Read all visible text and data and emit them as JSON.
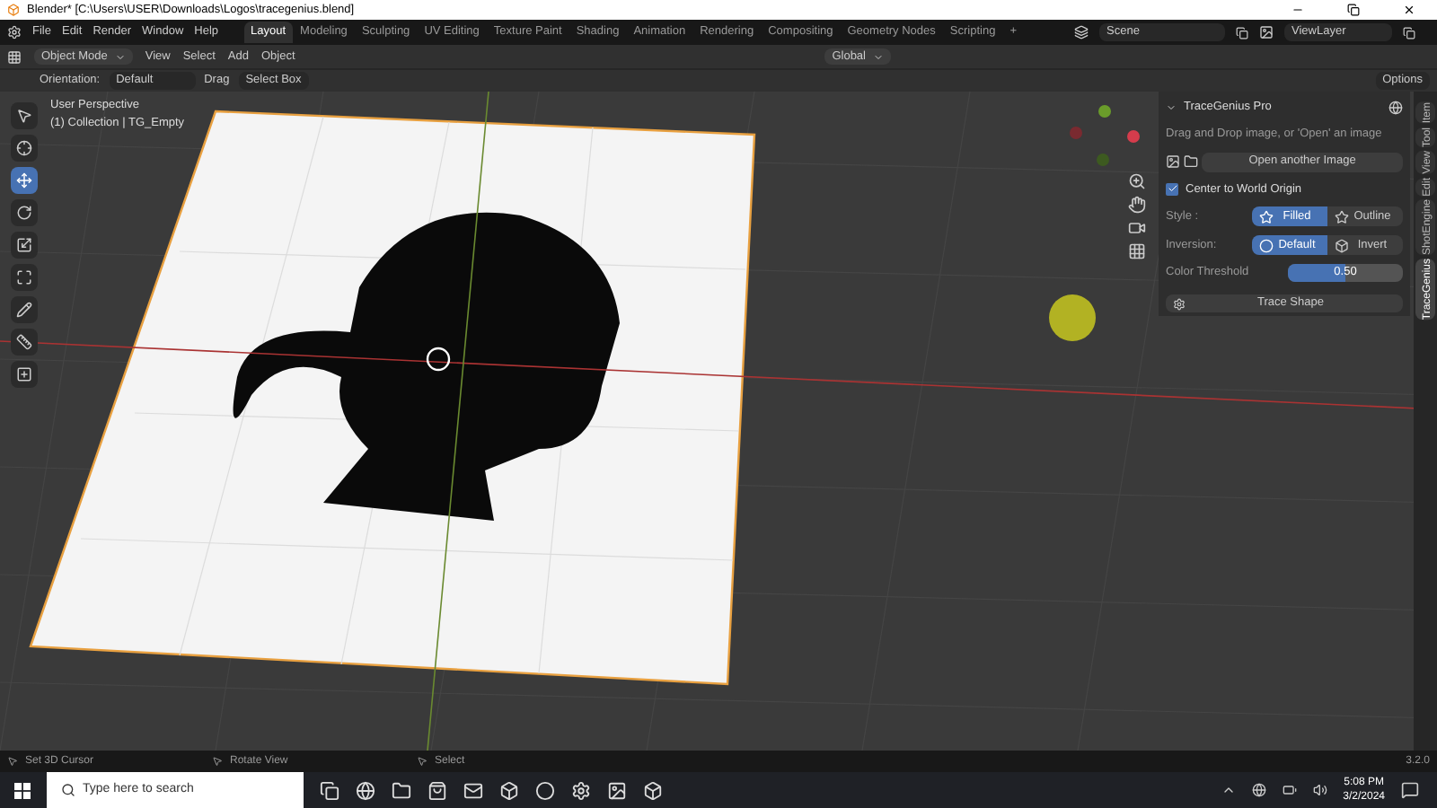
{
  "window": {
    "title": "Blender* [C:\\Users\\USER\\Downloads\\Logos\\tracegenius.blend]"
  },
  "menu": [
    "File",
    "Edit",
    "Render",
    "Window",
    "Help"
  ],
  "workspaces": [
    {
      "label": "Layout",
      "selected": true
    },
    {
      "label": "Modeling",
      "selected": false
    },
    {
      "label": "Sculpting",
      "selected": false
    },
    {
      "label": "UV Editing",
      "selected": false
    },
    {
      "label": "Texture Paint",
      "selected": false
    },
    {
      "label": "Shading",
      "selected": false
    },
    {
      "label": "Animation",
      "selected": false
    },
    {
      "label": "Rendering",
      "selected": false
    },
    {
      "label": "Compositing",
      "selected": false
    },
    {
      "label": "Geometry Nodes",
      "selected": false
    },
    {
      "label": "Scripting",
      "selected": false
    }
  ],
  "add_workspace": "+",
  "scene": "Scene",
  "view_layer": "ViewLayer",
  "header": {
    "mode": "Object Mode",
    "menus": [
      "View",
      "Select",
      "Add",
      "Object"
    ],
    "transform": "Global"
  },
  "tool_settings": {
    "orientation_label": "Orientation:",
    "orientation": "Default",
    "drag_label": "Drag",
    "drag": "Select Box",
    "options": "Options"
  },
  "viewport": {
    "perspective": "User Perspective",
    "collection": "(1) Collection | TG_Empty"
  },
  "tools": [
    {
      "kind": "select",
      "selected": false
    },
    {
      "kind": "cursor",
      "selected": false
    },
    {
      "kind": "move",
      "selected": true
    },
    {
      "kind": "rotate",
      "selected": false
    },
    {
      "kind": "scale",
      "selected": false
    },
    {
      "kind": "transform",
      "selected": false
    },
    {
      "kind": "annotate",
      "selected": false
    },
    {
      "kind": "measure",
      "selected": false
    },
    {
      "kind": "add",
      "selected": false
    }
  ],
  "panel": {
    "title": "TraceGenius Pro",
    "hint": "Drag and Drop image, or 'Open' an image",
    "open_button": "Open another Image",
    "center": {
      "label": "Center to World Origin",
      "checked": true
    },
    "style": {
      "label": "Style :",
      "options": [
        {
          "label": "Filled",
          "selected": true
        },
        {
          "label": "Outline",
          "selected": false
        }
      ]
    },
    "inversion": {
      "label": "Inversion:",
      "options": [
        {
          "label": "Default",
          "selected": true
        },
        {
          "label": "Invert",
          "selected": false
        }
      ]
    },
    "threshold": {
      "label": "Color Threshold",
      "value": "0.50",
      "level": 0.5
    },
    "trace_button": "Trace Shape"
  },
  "sidebar_tabs": [
    {
      "label": "Item",
      "selected": false
    },
    {
      "label": "Tool",
      "selected": false
    },
    {
      "label": "View",
      "selected": false
    },
    {
      "label": "Edit",
      "selected": false
    },
    {
      "label": "ShotEngine",
      "selected": false
    },
    {
      "label": "TraceGenius",
      "selected": true
    }
  ],
  "status_bar": {
    "items": [
      "Set 3D Cursor",
      "Rotate View",
      "Select"
    ],
    "version": "3.2.0"
  },
  "taskbar": {
    "search_placeholder": "Type here to search",
    "time": "5:08 PM",
    "date": "3/2/2024"
  }
}
